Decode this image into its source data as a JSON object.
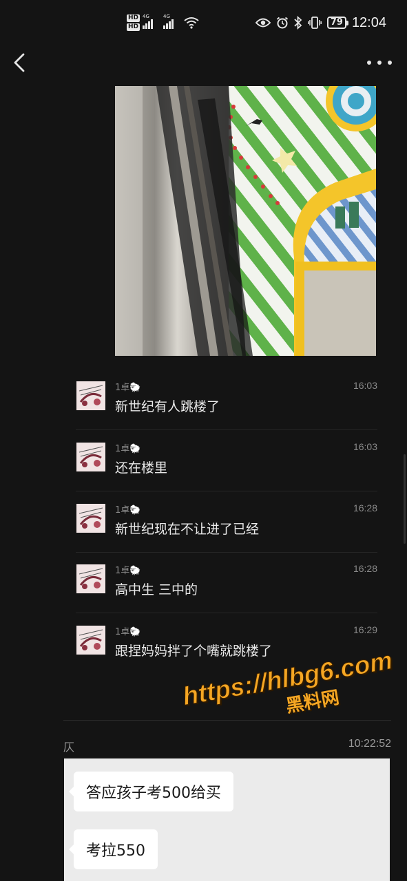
{
  "status_bar": {
    "hd_badges": [
      "HD",
      "HD"
    ],
    "network_labels": [
      "4G",
      "4G"
    ],
    "battery": "79",
    "time": "12:04"
  },
  "nav": {
    "back_icon": "chevron-left-icon",
    "more_icon": "more-dots-icon"
  },
  "messages": [
    {
      "sender": "1卓🐑",
      "time": "16:03",
      "text": "新世纪有人跳楼了"
    },
    {
      "sender": "1卓🐑",
      "time": "16:03",
      "text": "还在楼里"
    },
    {
      "sender": "1卓🐑",
      "time": "16:28",
      "text": "新世纪现在不让进了已经"
    },
    {
      "sender": "1卓🐑",
      "time": "16:28",
      "text": "高中生 三中的"
    },
    {
      "sender": "1卓🐑",
      "time": "16:29",
      "text": "跟捏妈妈拌了个嘴就跳楼了"
    }
  ],
  "watermark": {
    "url": "https://hlbg6.com",
    "name": "黑料网",
    "color": "#f5a623"
  },
  "forwarded": {
    "sender": "仄",
    "time": "10:22:52",
    "bubbles": [
      "答应孩子考500给买",
      "考拉550"
    ]
  }
}
